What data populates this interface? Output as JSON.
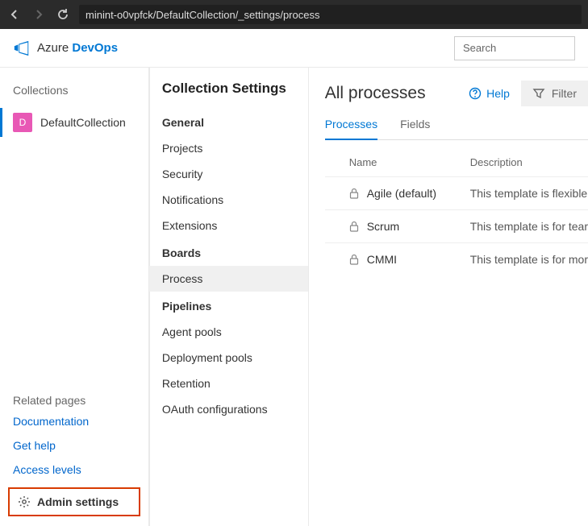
{
  "browser": {
    "url": "minint-o0vpfck/DefaultCollection/_settings/process"
  },
  "brand": {
    "text1": "Azure",
    "text2": "DevOps"
  },
  "search": {
    "placeholder": "Search"
  },
  "leftNav": {
    "collectionsLabel": "Collections",
    "collectionInitial": "D",
    "collectionName": "DefaultCollection",
    "relatedPagesLabel": "Related pages",
    "links": {
      "documentation": "Documentation",
      "getHelp": "Get help",
      "accessLevels": "Access levels"
    },
    "adminSettings": "Admin settings"
  },
  "settingsNav": {
    "title": "Collection Settings",
    "groups": [
      {
        "title": "General",
        "items": [
          "Projects",
          "Security",
          "Notifications",
          "Extensions"
        ]
      },
      {
        "title": "Boards",
        "items": [
          "Process"
        ],
        "selected": "Process"
      },
      {
        "title": "Pipelines",
        "items": [
          "Agent pools",
          "Deployment pools",
          "Retention",
          "OAuth configurations"
        ]
      }
    ]
  },
  "main": {
    "title": "All processes",
    "helpLabel": "Help",
    "filterLabel": "Filter",
    "tabs": {
      "processes": "Processes",
      "fields": "Fields",
      "active": "processes"
    },
    "columns": {
      "name": "Name",
      "description": "Description"
    },
    "rows": [
      {
        "name": "Agile (default)",
        "description": "This template is flexible"
      },
      {
        "name": "Scrum",
        "description": "This template is for tear"
      },
      {
        "name": "CMMI",
        "description": "This template is for mor"
      }
    ]
  }
}
